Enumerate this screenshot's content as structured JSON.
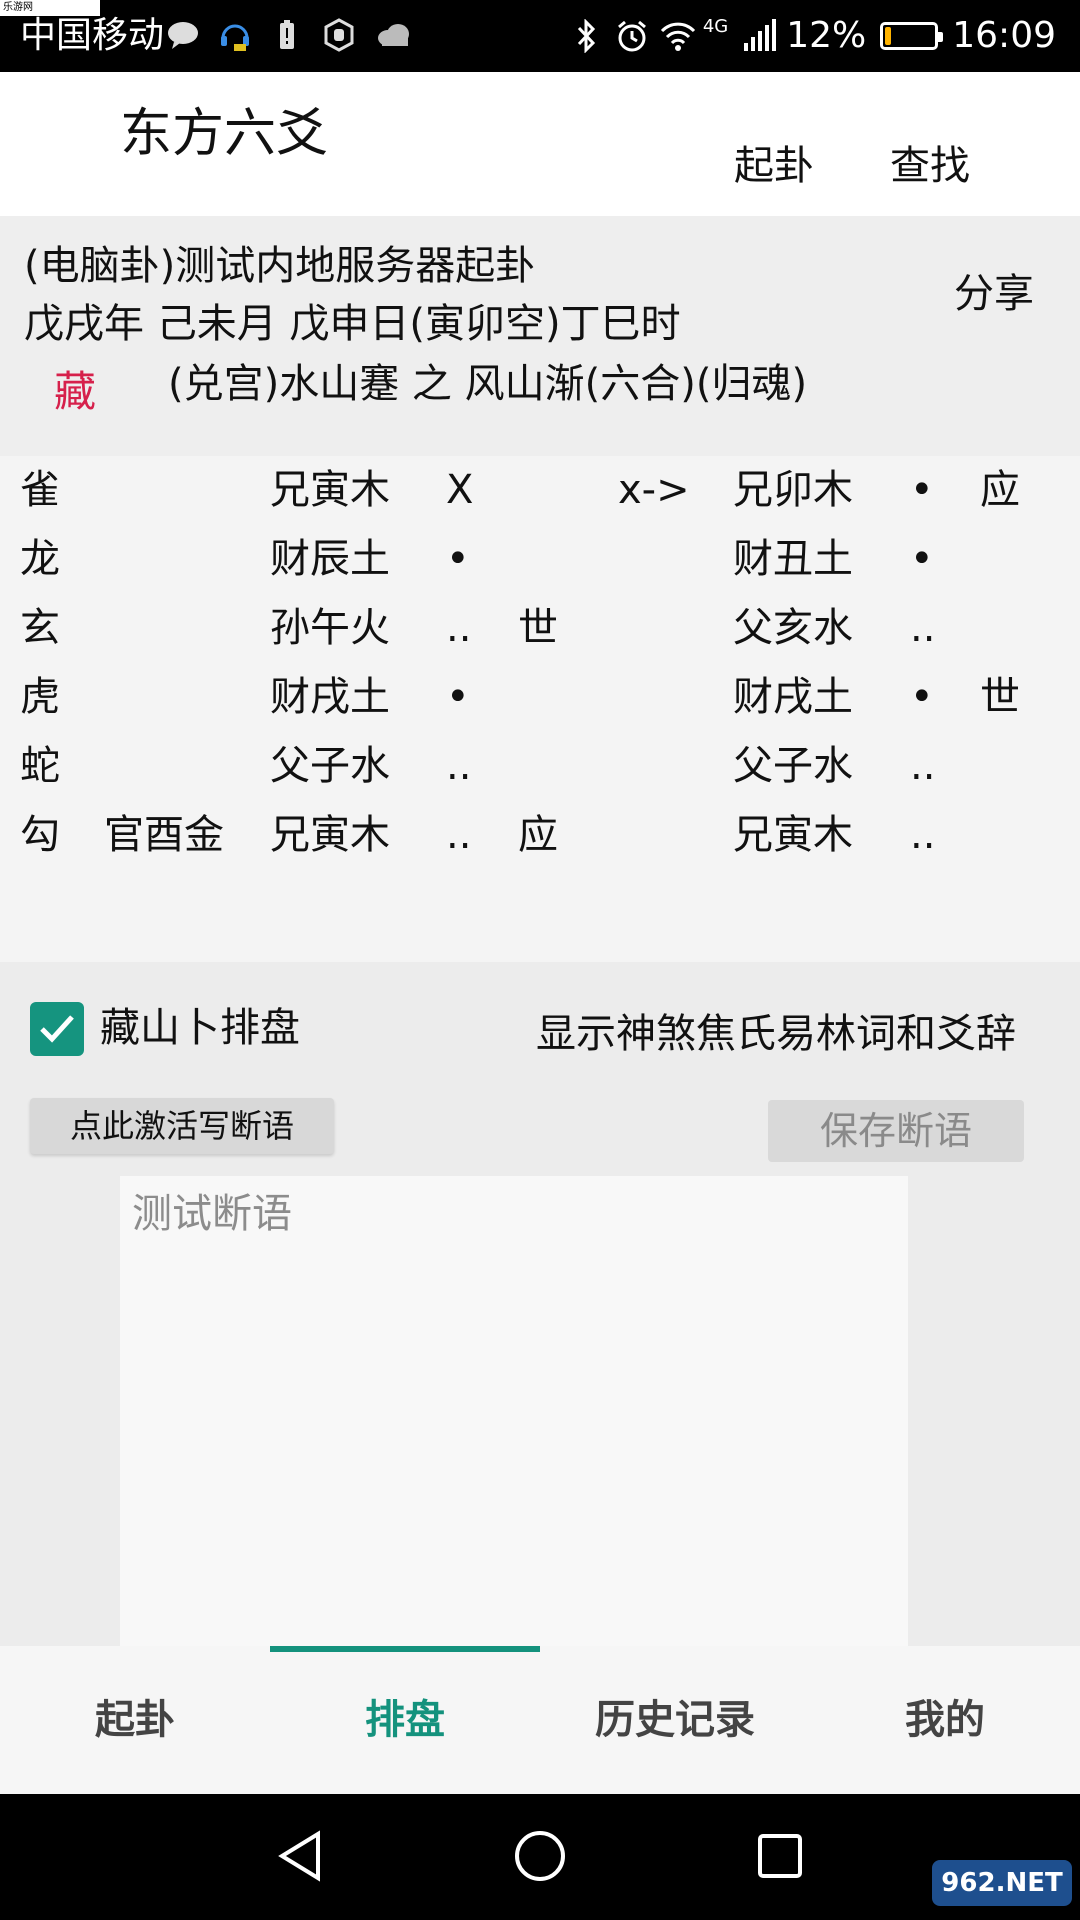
{
  "status_bar": {
    "watermark": "乐游网 www.962.net",
    "carrier": "中国移动",
    "network": "4G",
    "battery": "12%",
    "battery_level": 0.12,
    "time": "16:09",
    "icons_left": [
      "chat-bubble-icon",
      "headset-icon",
      "battery-saver-icon",
      "hand-icon",
      "cloud-icon"
    ],
    "icons_right": [
      "bluetooth-icon",
      "alarm-icon",
      "wifi-icon",
      "signal-icon"
    ]
  },
  "appbar": {
    "title": "东方六爻",
    "actions": [
      "起卦",
      "查找"
    ]
  },
  "header": {
    "line1": "(电脑卦)测试内地服务器起卦",
    "line2": "戊戌年 己未月 戊申日(寅卯空)丁巳时",
    "share": "分享",
    "cang": "藏",
    "gua": "(兑宫)水山蹇 之 风山渐(六合)(归魂)",
    "cang_color": "#d6204b"
  },
  "table": {
    "rows": [
      {
        "god": "雀",
        "hidden": "",
        "main": "兄寅木",
        "mark": "X",
        "shiying": "",
        "arrow": "x->",
        "change": "兄卯木",
        "cmark": "•",
        "cshiying": "应"
      },
      {
        "god": "龙",
        "hidden": "",
        "main": "财辰土",
        "mark": "•",
        "shiying": "",
        "arrow": "",
        "change": "财丑土",
        "cmark": "•",
        "cshiying": ""
      },
      {
        "god": "玄",
        "hidden": "",
        "main": "孙午火",
        "mark": "..",
        "shiying": "世",
        "arrow": "",
        "change": "父亥水",
        "cmark": "..",
        "cshiying": ""
      },
      {
        "god": "虎",
        "hidden": "",
        "main": "财戌土",
        "mark": "•",
        "shiying": "",
        "arrow": "",
        "change": "财戌土",
        "cmark": "•",
        "cshiying": "世"
      },
      {
        "god": "蛇",
        "hidden": "",
        "main": "父子水",
        "mark": "..",
        "shiying": "",
        "arrow": "",
        "change": "父子水",
        "cmark": "..",
        "cshiying": ""
      },
      {
        "god": "勾",
        "hidden": "官酉金",
        "main": "兄寅木",
        "mark": "..",
        "shiying": "应",
        "arrow": "",
        "change": "兄寅木",
        "cmark": "..",
        "cshiying": ""
      }
    ]
  },
  "options": {
    "checkbox_label": "藏山卜排盘",
    "checkbox_checked": true,
    "show_link": "显示神煞焦氏易林词和爻辞",
    "activate_button": "点此激活写断语",
    "save_button": "保存断语",
    "notes_placeholder": "测试断语"
  },
  "bottom_nav": {
    "tabs": [
      "起卦",
      "排盘",
      "历史记录",
      "我的"
    ],
    "active": "排盘",
    "accent": "#14927d"
  },
  "watermark_badge": "962.NET"
}
